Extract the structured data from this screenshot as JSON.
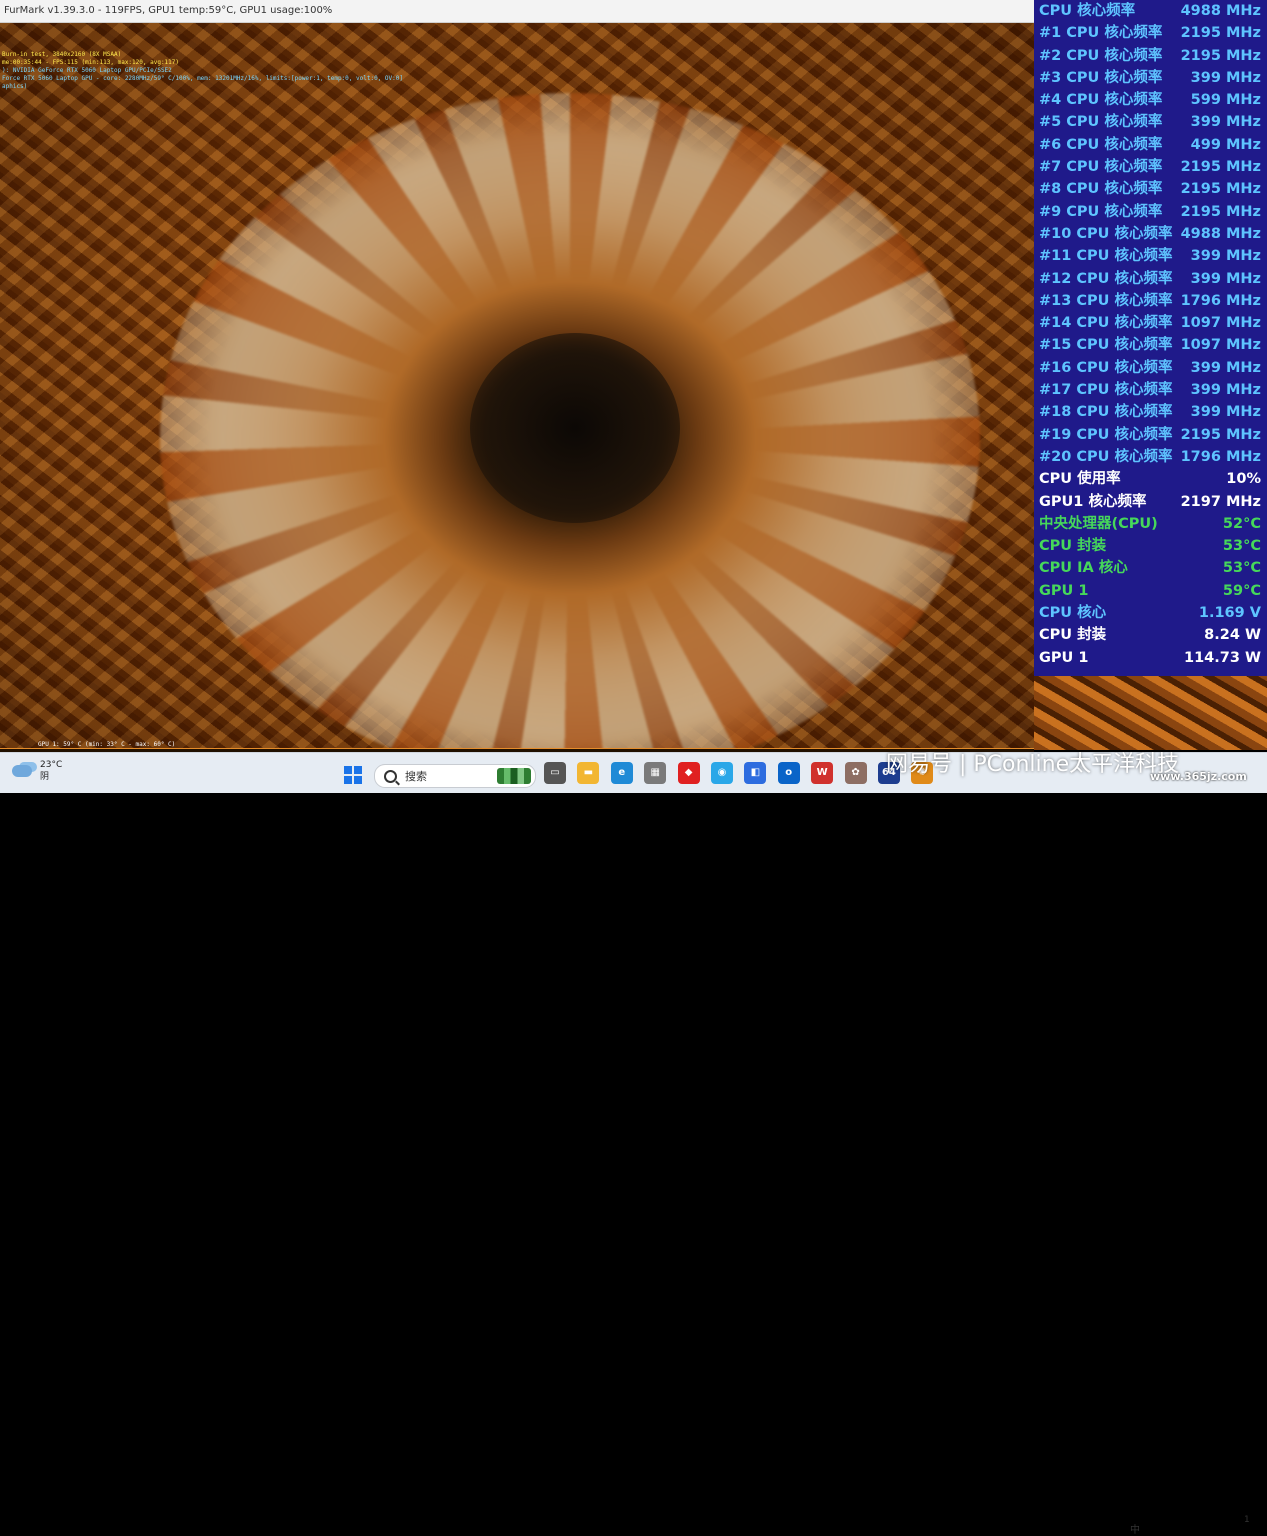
{
  "window": {
    "title": "FurMark v1.39.3.0 - 119FPS, GPU1 temp:59°C, GPU1 usage:100%"
  },
  "osd": {
    "line1": "Burn-in test, 3840x2160 (8X MSAA)",
    "line2": "me:00:35:44 - FPS:115 (min:113, max:120, avg:117)",
    "line3": "): NVIDIA GeForce RTX 5060 Laptop GPU/PCIe/SSE2",
    "line4": "Force RTX 5060 Laptop GPU - core: 2280MHz/59° C/100%, mem: 13201MHz/16%, limits:[power:1, temp:0, volt:0, OV:0]",
    "line5": "aphics)",
    "gpu_graph": "GPU 1: 59° C (min: 33° C - max: 60° C)"
  },
  "sensors": [
    {
      "label": "CPU 核心频率",
      "value": "4988 MHz",
      "color": "blue"
    },
    {
      "label": "#1 CPU 核心频率",
      "value": "2195 MHz",
      "color": "blue"
    },
    {
      "label": "#2 CPU 核心频率",
      "value": "2195 MHz",
      "color": "blue"
    },
    {
      "label": "#3 CPU 核心频率",
      "value": "399 MHz",
      "color": "blue"
    },
    {
      "label": "#4 CPU 核心频率",
      "value": "599 MHz",
      "color": "blue"
    },
    {
      "label": "#5 CPU 核心频率",
      "value": "399 MHz",
      "color": "blue"
    },
    {
      "label": "#6 CPU 核心频率",
      "value": "499 MHz",
      "color": "blue"
    },
    {
      "label": "#7 CPU 核心频率",
      "value": "2195 MHz",
      "color": "blue"
    },
    {
      "label": "#8 CPU 核心频率",
      "value": "2195 MHz",
      "color": "blue"
    },
    {
      "label": "#9 CPU 核心频率",
      "value": "2195 MHz",
      "color": "blue"
    },
    {
      "label": "#10 CPU 核心频率",
      "value": "4988 MHz",
      "color": "blue"
    },
    {
      "label": "#11 CPU 核心频率",
      "value": "399 MHz",
      "color": "blue"
    },
    {
      "label": "#12 CPU 核心频率",
      "value": "399 MHz",
      "color": "blue"
    },
    {
      "label": "#13 CPU 核心频率",
      "value": "1796 MHz",
      "color": "blue"
    },
    {
      "label": "#14 CPU 核心频率",
      "value": "1097 MHz",
      "color": "blue"
    },
    {
      "label": "#15 CPU 核心频率",
      "value": "1097 MHz",
      "color": "blue"
    },
    {
      "label": "#16 CPU 核心频率",
      "value": "399 MHz",
      "color": "blue"
    },
    {
      "label": "#17 CPU 核心频率",
      "value": "399 MHz",
      "color": "blue"
    },
    {
      "label": "#18 CPU 核心频率",
      "value": "399 MHz",
      "color": "blue"
    },
    {
      "label": "#19 CPU 核心频率",
      "value": "2195 MHz",
      "color": "blue"
    },
    {
      "label": "#20 CPU 核心频率",
      "value": "1796 MHz",
      "color": "blue"
    },
    {
      "label": "CPU 使用率",
      "value": "10%",
      "color": "white"
    },
    {
      "label": "GPU1 核心频率",
      "value": "2197 MHz",
      "color": "white"
    },
    {
      "label": "中央处理器(CPU)",
      "value": "52°C",
      "color": "green"
    },
    {
      "label": "CPU 封装",
      "value": "53°C",
      "color": "green"
    },
    {
      "label": "CPU IA 核心",
      "value": "53°C",
      "color": "green"
    },
    {
      "label": "GPU 1",
      "value": "59°C",
      "color": "green"
    },
    {
      "label": "CPU 核心",
      "value": "1.169 V",
      "color": "blue"
    },
    {
      "label": "CPU 封装",
      "value": "8.24 W",
      "color": "white"
    },
    {
      "label": "GPU 1",
      "value": "114.73 W",
      "color": "white"
    }
  ],
  "colors": {
    "overlay_bg": "#1f1a8a",
    "blue": "#5ec4ff",
    "green": "#46d85a",
    "white": "#ffffff"
  },
  "taskbar": {
    "weather_temp": "23°C",
    "weather_desc": "阴",
    "search_placeholder": "搜索",
    "icons": [
      {
        "name": "task-view-icon",
        "color": "#555555",
        "glyph": "▭"
      },
      {
        "name": "file-explorer-icon",
        "color": "#f2b632",
        "glyph": "▬"
      },
      {
        "name": "edge-icon",
        "color": "#1f8ad6",
        "glyph": "e"
      },
      {
        "name": "store-icon",
        "color": "#7a7a7a",
        "glyph": "▦"
      },
      {
        "name": "red-app-icon",
        "color": "#e02020",
        "glyph": "◆"
      },
      {
        "name": "globe-app-icon",
        "color": "#2aa7e8",
        "glyph": "◉"
      },
      {
        "name": "copilot-icon",
        "color": "#2d6cdf",
        "glyph": "◧"
      },
      {
        "name": "outlook-icon",
        "color": "#0a64c8",
        "glyph": "o"
      },
      {
        "name": "wps-icon",
        "color": "#d0312d",
        "glyph": "W"
      },
      {
        "name": "bug-app-icon",
        "color": "#8d6e63",
        "glyph": "✿"
      },
      {
        "name": "aida64-icon",
        "color": "#1d3d8f",
        "glyph": "64"
      },
      {
        "name": "furmark-icon",
        "color": "#e08a18",
        "glyph": "✺"
      }
    ],
    "tray_text": "中",
    "clock_fragment": "1"
  },
  "watermark": {
    "text": "网易号 | PConline太平洋科技",
    "site": "www.365jz.com"
  }
}
